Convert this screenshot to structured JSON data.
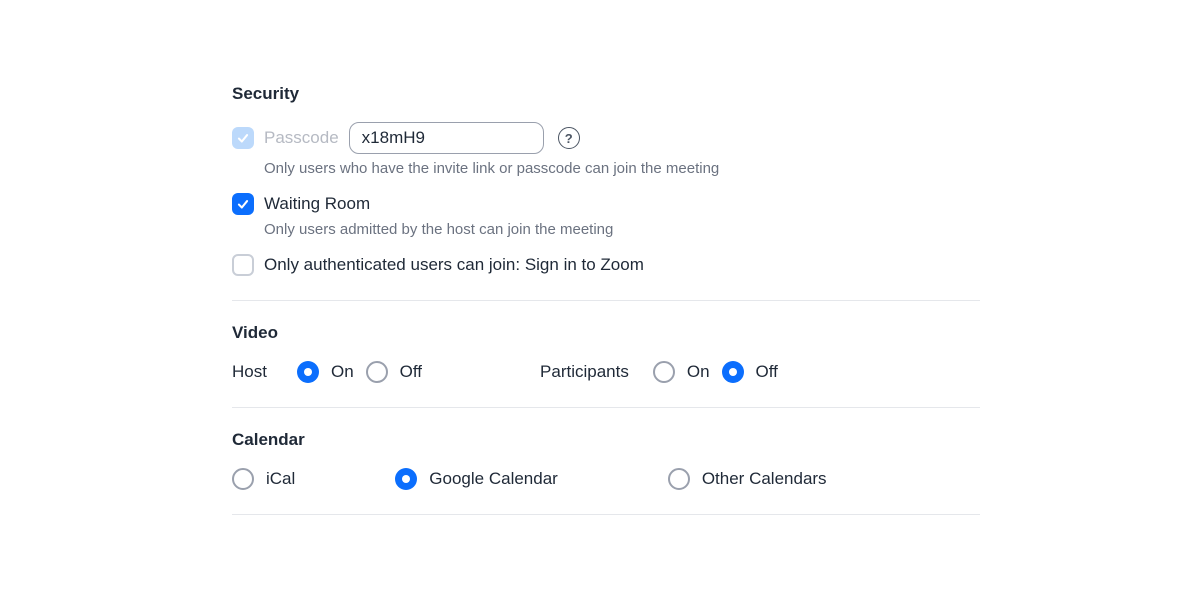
{
  "security": {
    "title": "Security",
    "passcode": {
      "label": "Passcode",
      "value": "x18mH9",
      "checked": true,
      "locked": true,
      "description": "Only users who have the invite link or passcode can join the meeting"
    },
    "waiting_room": {
      "label": "Waiting Room",
      "checked": true,
      "description": "Only users admitted by the host can join the meeting"
    },
    "auth_only": {
      "label": "Only authenticated users can join: Sign in to Zoom",
      "checked": false
    }
  },
  "video": {
    "title": "Video",
    "host": {
      "label": "Host",
      "on_label": "On",
      "off_label": "Off",
      "value": "on"
    },
    "participants": {
      "label": "Participants",
      "on_label": "On",
      "off_label": "Off",
      "value": "off"
    }
  },
  "calendar": {
    "title": "Calendar",
    "options": [
      {
        "label": "iCal",
        "selected": false
      },
      {
        "label": "Google Calendar",
        "selected": true
      },
      {
        "label": "Other Calendars",
        "selected": false
      }
    ]
  },
  "icons": {
    "help": "help-icon"
  }
}
